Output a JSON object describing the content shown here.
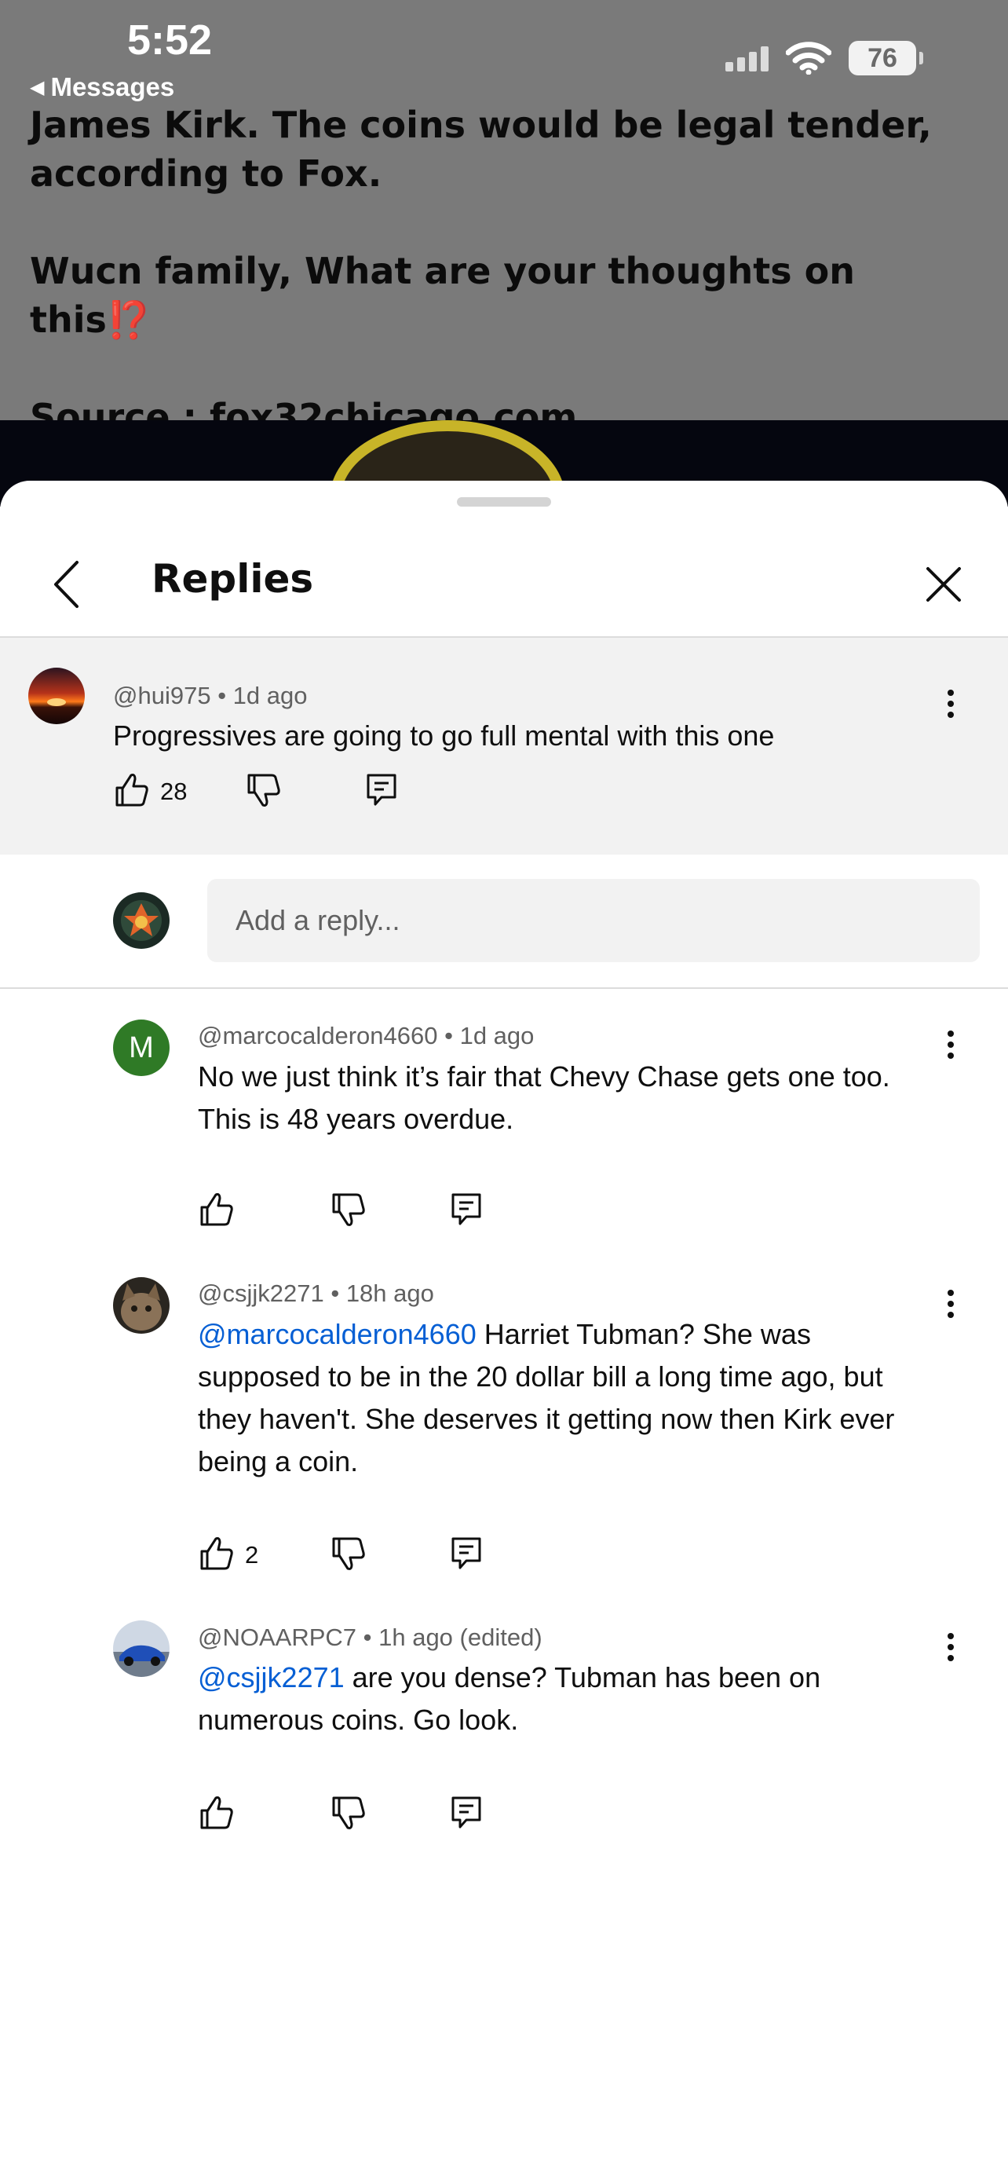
{
  "status_bar": {
    "time": "5:52",
    "back_label": "Messages",
    "battery": "76"
  },
  "background_post": {
    "text": "James Kirk. The coins would be legal tender,\naccording to Fox.\n\nWucn family, What are your thoughts on this",
    "emoji": "⁉️",
    "source": "Source : fox32chicago.com"
  },
  "sheet": {
    "title": "Replies"
  },
  "parent_comment": {
    "author": "@hui975",
    "time": "1d ago",
    "text": "Progressives are going to go full mental with this one",
    "likes": "28"
  },
  "reply_box": {
    "placeholder": "Add a reply..."
  },
  "replies": [
    {
      "avatar_letter": "M",
      "author": "@marcocalderon4660",
      "time": "1d ago",
      "text": "No we just think it’s fair that Chevy Chase gets one too. This is 48 years overdue.",
      "likes": ""
    },
    {
      "author": "@csjjk2271",
      "time": "18h ago",
      "mention": "@marcocalderon4660",
      "text": " Harriet Tubman? She was supposed to be in the 20 dollar bill a long time ago, but they haven't. She deserves it getting now then Kirk ever being a coin.",
      "likes": "2"
    },
    {
      "author": "@NOAARPC7",
      "time": "1h ago (edited)",
      "mention": "@csjjk2271",
      "text": " are you dense?  Tubman has been on numerous coins.  Go look.",
      "likes": ""
    }
  ],
  "icons": {
    "like": "thumbs-up-icon",
    "dislike": "thumbs-down-icon",
    "reply": "reply-comment-icon",
    "more": "more-vertical-icon",
    "back": "chevron-left-icon",
    "close": "close-icon"
  },
  "colors": {
    "mention": "#065fd4",
    "letter_avatar": "#2f7a26",
    "parent_bg": "#f2f2f2"
  }
}
